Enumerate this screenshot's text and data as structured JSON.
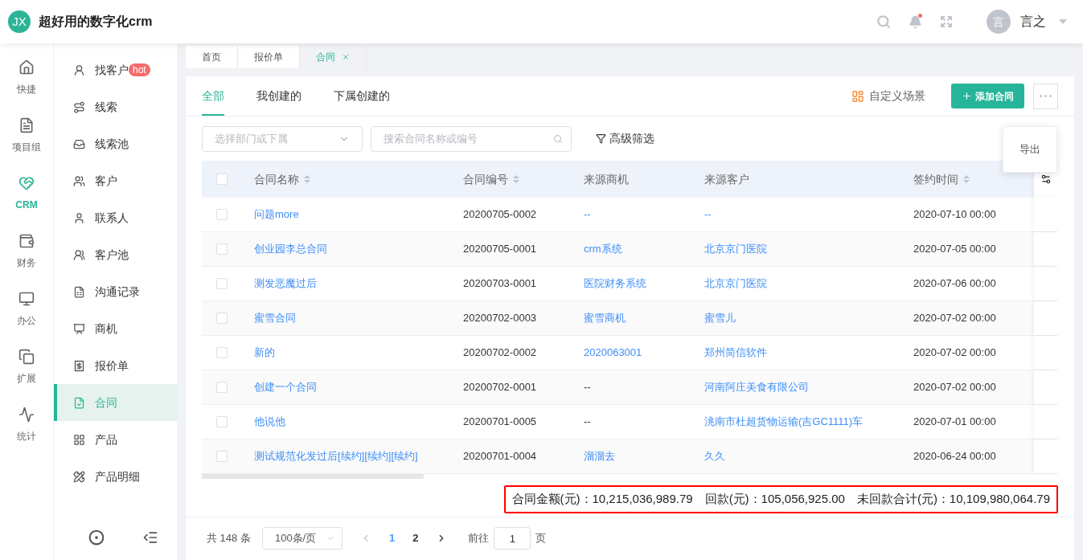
{
  "header": {
    "logo": "JX",
    "title": "超好用的数字化crm",
    "avatar": "言",
    "user": "言之"
  },
  "rail": [
    {
      "label": "快捷",
      "selected": false
    },
    {
      "label": "项目组",
      "selected": false
    },
    {
      "label": "CRM",
      "selected": true
    },
    {
      "label": "财务",
      "selected": false
    },
    {
      "label": "办公",
      "selected": false
    },
    {
      "label": "扩展",
      "selected": false
    },
    {
      "label": "统计",
      "selected": false
    }
  ],
  "submenu": [
    {
      "label": "找客户",
      "badge": "hot",
      "selected": false
    },
    {
      "label": "线索",
      "selected": false
    },
    {
      "label": "线索池",
      "selected": false
    },
    {
      "label": "客户",
      "selected": false
    },
    {
      "label": "联系人",
      "selected": false
    },
    {
      "label": "客户池",
      "selected": false
    },
    {
      "label": "沟通记录",
      "selected": false
    },
    {
      "label": "商机",
      "selected": false
    },
    {
      "label": "报价单",
      "selected": false
    },
    {
      "label": "合同",
      "selected": true
    },
    {
      "label": "产品",
      "selected": false
    },
    {
      "label": "产品明细",
      "selected": false
    }
  ],
  "page_tabs": [
    {
      "label": "首页",
      "selected": false,
      "closable": false
    },
    {
      "label": "报价单",
      "selected": false,
      "closable": false
    },
    {
      "label": "合同",
      "selected": true,
      "closable": true
    }
  ],
  "view_tabs": [
    {
      "label": "全部",
      "selected": true
    },
    {
      "label": "我创建的",
      "selected": false
    },
    {
      "label": "下属创建的",
      "selected": false
    }
  ],
  "scene_button": "自定义场景",
  "add_button": "添加合同",
  "more_menu": [
    "导出"
  ],
  "filters": {
    "department_placeholder": "选择部门或下属",
    "search_placeholder": "搜索合同名称或编号",
    "advanced": "高级筛选"
  },
  "table": {
    "select_all_checked": false,
    "columns": [
      {
        "label": "合同名称",
        "sortable": true
      },
      {
        "label": "合同编号",
        "sortable": true
      },
      {
        "label": "来源商机",
        "sortable": false
      },
      {
        "label": "来源客户",
        "sortable": false
      },
      {
        "label": "签约时间",
        "sortable": true
      }
    ],
    "rows": [
      {
        "checked": false,
        "name": "问题more",
        "number": "20200705-0002",
        "opportunity": {
          "text": "--",
          "link": true
        },
        "customer": {
          "text": "--",
          "link": true
        },
        "sign_time": "2020-07-10 00:00"
      },
      {
        "checked": false,
        "name": "创业园李总合同",
        "number": "20200705-0001",
        "opportunity": {
          "text": "crm系统",
          "link": true
        },
        "customer": {
          "text": "北京京门医院",
          "link": true
        },
        "sign_time": "2020-07-05 00:00"
      },
      {
        "checked": false,
        "name": "测发恶魔过后",
        "number": "20200703-0001",
        "opportunity": {
          "text": "医院财务系统",
          "link": true
        },
        "customer": {
          "text": "北京京门医院",
          "link": true
        },
        "sign_time": "2020-07-06 00:00"
      },
      {
        "checked": false,
        "name": "蜜雪合同",
        "number": "20200702-0003",
        "opportunity": {
          "text": "蜜雪商机",
          "link": true
        },
        "customer": {
          "text": "蜜雪儿",
          "link": true
        },
        "sign_time": "2020-07-02 00:00"
      },
      {
        "checked": false,
        "name": "新的",
        "number": "20200702-0002",
        "opportunity": {
          "text": "2020063001",
          "link": true
        },
        "customer": {
          "text": "郑州简信软件",
          "link": true
        },
        "sign_time": "2020-07-02 00:00"
      },
      {
        "checked": false,
        "name": "创建一个合同",
        "number": "20200702-0001",
        "opportunity": {
          "text": "--",
          "link": false
        },
        "customer": {
          "text": "河南阿庄美食有限公司",
          "link": true
        },
        "sign_time": "2020-07-02 00:00"
      },
      {
        "checked": false,
        "name": "他说他",
        "number": "20200701-0005",
        "opportunity": {
          "text": "--",
          "link": false
        },
        "customer": {
          "text": "洮南市杜超货物运输(吉GC1111)车",
          "link": true
        },
        "sign_time": "2020-07-01 00:00"
      },
      {
        "checked": false,
        "name": "测试规范化发过后[续约][续约][续约]",
        "number": "20200701-0004",
        "opportunity": {
          "text": "溜溜去",
          "link": true
        },
        "customer": {
          "text": "久久",
          "link": true
        },
        "sign_time": "2020-06-24 00:00"
      }
    ]
  },
  "summary": "合同金额(元)：10,215,036,989.79　回款(元)：105,056,925.00　未回款合计(元)：10,109,980,064.79",
  "pagination": {
    "total": "共 148 条",
    "page_size": "100条/页",
    "pages": [
      {
        "label": "1",
        "selected": true
      },
      {
        "label": "2",
        "selected": false
      }
    ],
    "goto": "前往",
    "goto_value": "1",
    "goto_suffix": "页"
  }
}
